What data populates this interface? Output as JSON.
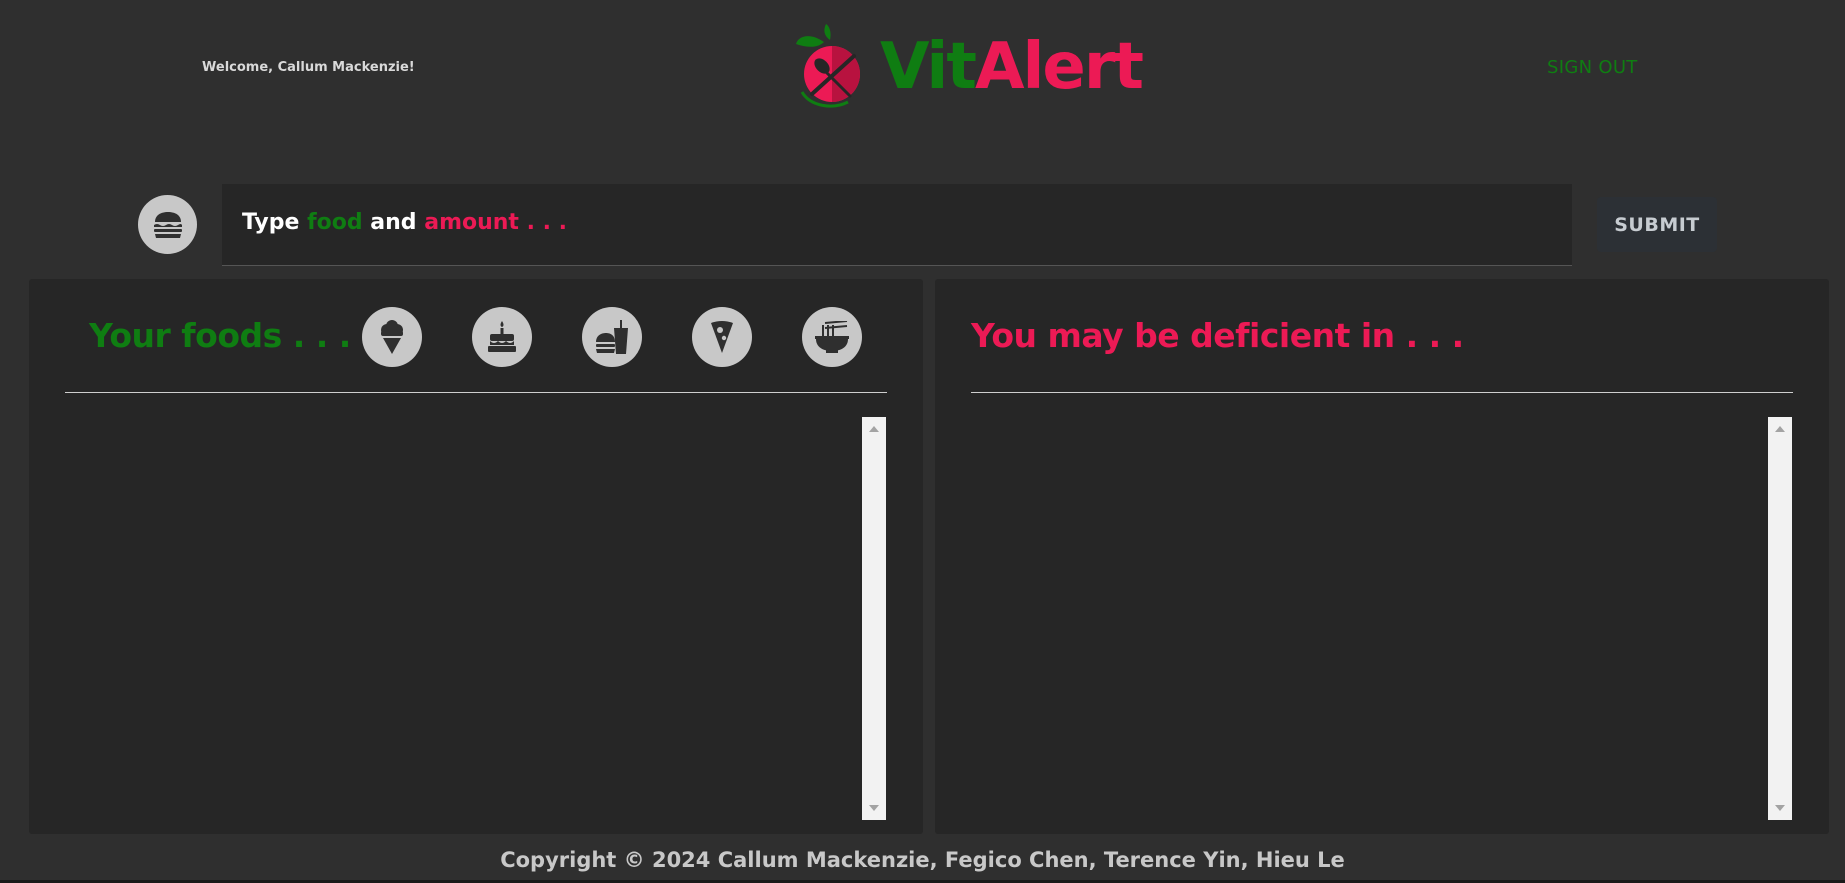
{
  "header": {
    "welcome_text": "Welcome, Callum Mackenzie!",
    "logo_vit": "Vit",
    "logo_alert": "Alert",
    "sign_out_label": "SIGN OUT"
  },
  "search": {
    "placeholder_type": "Type ",
    "placeholder_food": "food",
    "placeholder_and": " and ",
    "placeholder_amount": "amount . . .",
    "value": "",
    "submit_label": "SUBMIT",
    "icon": "burger-icon"
  },
  "foods_panel": {
    "title": "Your foods . . .",
    "categories": [
      {
        "name": "ice-cream",
        "icon": "ice-cream-icon"
      },
      {
        "name": "cake",
        "icon": "cake-icon"
      },
      {
        "name": "fast-food",
        "icon": "burger-drink-icon"
      },
      {
        "name": "pizza",
        "icon": "pizza-icon"
      },
      {
        "name": "noodles",
        "icon": "noodle-bowl-icon"
      }
    ],
    "items": []
  },
  "deficiency_panel": {
    "title": "You may be deficient in . . .",
    "items": []
  },
  "footer": {
    "copyright": "Copyright © 2024 Callum Mackenzie, Fegico Chen, Terence Yin, Hieu Le"
  },
  "colors": {
    "green": "#0f7d12",
    "red": "#ec1a55",
    "background": "#2f2f2f",
    "panel": "#262626"
  }
}
